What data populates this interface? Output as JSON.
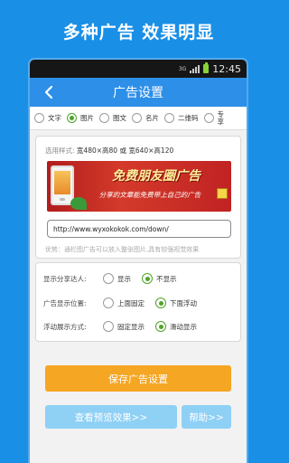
{
  "hero": {
    "title": "多种广告  效果明显"
  },
  "status_bar": {
    "network": "3G",
    "time": "12:45"
  },
  "title_bar": {
    "title": "广告设置"
  },
  "ad_types": [
    {
      "label": "文字",
      "selected": false
    },
    {
      "label": "图片",
      "selected": true
    },
    {
      "label": "图文",
      "selected": false
    },
    {
      "label": "名片",
      "selected": false
    },
    {
      "label": "二维码",
      "selected": false
    },
    {
      "label": "专享",
      "selected": false
    }
  ],
  "image_settings": {
    "size_label": "选用样式:",
    "size_value": "宽480×高80 或 宽640×高120",
    "banner": {
      "title": "免费朋友圈广告",
      "subtitle": "分享的文章能免费带上自己的广告"
    },
    "url_value": "http://www.wyxokokok.com/down/",
    "hint": "优势：通栏图广告可以放入整张图片,具有较强视觉效果"
  },
  "display_options": {
    "rows": [
      {
        "label": "显示分享达人:",
        "options": [
          {
            "label": "显示",
            "selected": false
          },
          {
            "label": "不显示",
            "selected": true
          }
        ]
      },
      {
        "label": "广告显示位置:",
        "options": [
          {
            "label": "上面固定",
            "selected": false
          },
          {
            "label": "下面浮动",
            "selected": true
          }
        ]
      },
      {
        "label": "浮动展示方式:",
        "options": [
          {
            "label": "固定显示",
            "selected": false
          },
          {
            "label": "滑动显示",
            "selected": true
          }
        ]
      }
    ]
  },
  "buttons": {
    "save": "保存广告设置",
    "preview": "查看预览效果>>",
    "help": "帮助>>"
  },
  "colors": {
    "page_background": "#1a8fe6",
    "title_bar": "#2d8fe8",
    "save_button": "#f5a623",
    "secondary_button": "#8fd0f5",
    "radio_selected": "#4fa328"
  }
}
